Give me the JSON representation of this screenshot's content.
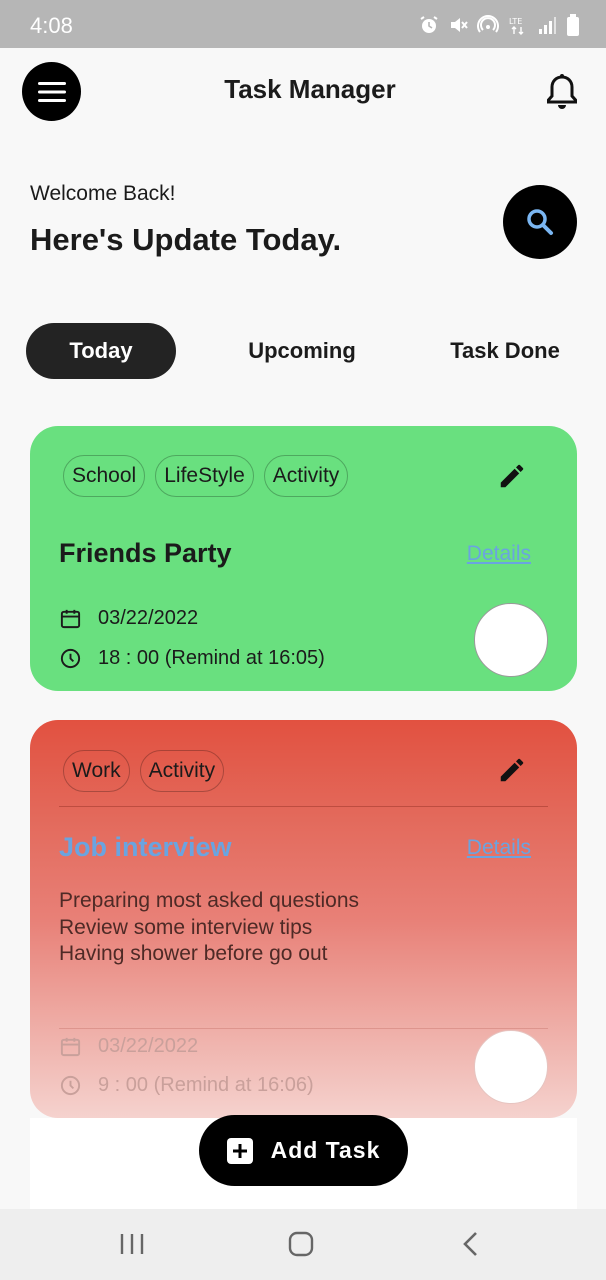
{
  "status": {
    "time": "4:08"
  },
  "app": {
    "title": "Task Manager"
  },
  "greeting": {
    "welcome": "Welcome Back!",
    "headline": "Here's Update Today."
  },
  "tabs": [
    {
      "label": "Today",
      "active": true
    },
    {
      "label": "Upcoming",
      "active": false
    },
    {
      "label": "Task Done",
      "active": false
    }
  ],
  "tasks": [
    {
      "tags": [
        "School",
        "LifeStyle",
        "Activity"
      ],
      "title": "Friends Party",
      "details": "Details",
      "date": "03/22/2022",
      "time": "18 : 00 (Remind at 16:05)",
      "color": "#69e07f"
    },
    {
      "tags": [
        "Work",
        "Activity"
      ],
      "title": "Job interview",
      "details": "Details",
      "notes": [
        "Preparing most asked questions",
        "Review some interview tips",
        "Having shower before go out"
      ],
      "date": "03/22/2022",
      "time": "9 : 00 (Remind at 16:06)",
      "color": "#e25140"
    }
  ],
  "add_button": {
    "label": "Add Task"
  },
  "colors": {
    "title_link": "#6aa4e0",
    "black": "#000000"
  }
}
